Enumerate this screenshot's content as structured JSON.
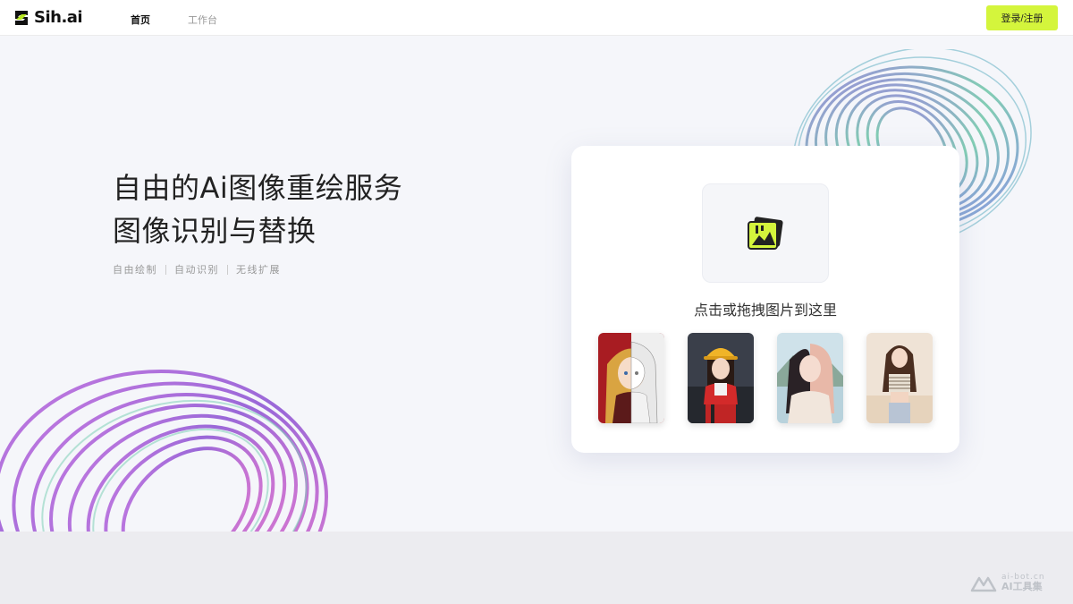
{
  "header": {
    "logo_text": "Sih.ai",
    "nav": [
      {
        "label": "首页",
        "active": true
      },
      {
        "label": "工作台",
        "active": false
      }
    ],
    "login_label": "登录/注册",
    "accent_color": "#d4f53c"
  },
  "hero": {
    "headline_line1": "自由的Ai图像重绘服务",
    "headline_line2": "图像识别与替换",
    "features": [
      "自由绘制",
      "自动识别",
      "无线扩展"
    ]
  },
  "upload": {
    "icon": "image-upload-icon",
    "prompt": "点击或拖拽图片到这里",
    "samples": [
      {
        "name": "sample-anime-sketch"
      },
      {
        "name": "sample-hardhat-girl"
      },
      {
        "name": "sample-two-tone-hair"
      },
      {
        "name": "sample-beach-portrait"
      }
    ]
  },
  "watermark": {
    "url": "ai-bot.cn",
    "name": "AI工具集"
  }
}
